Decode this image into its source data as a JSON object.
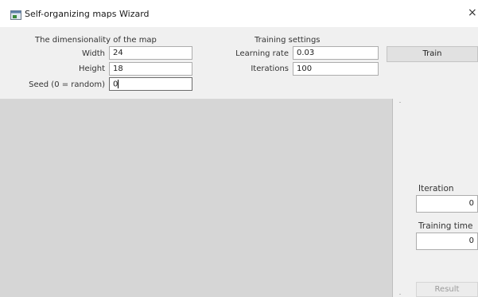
{
  "window": {
    "title": "Self-organizing maps Wizard",
    "close_glyph": "×",
    "app_icon": "app-window-icon"
  },
  "map_dimensionality": {
    "heading": "The dimensionality of the map",
    "width_label": "Width",
    "width_value": "24",
    "height_label": "Height",
    "height_value": "18",
    "seed_label": "Seed (0 = random)",
    "seed_value": "0"
  },
  "training_settings": {
    "heading": "Training settings",
    "learning_rate_label": "Learning rate",
    "learning_rate_value": "0.03",
    "iterations_label": "Iterations",
    "iterations_value": "100"
  },
  "buttons": {
    "train_label": "Train",
    "result_label": "Result"
  },
  "status": {
    "iteration_label": "Iteration",
    "iteration_value": "0",
    "training_time_label": "Training time",
    "training_time_value": "0"
  }
}
